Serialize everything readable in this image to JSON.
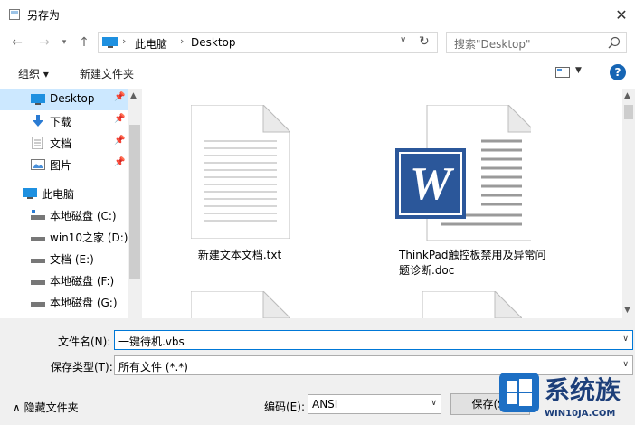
{
  "window": {
    "title": "另存为"
  },
  "address": {
    "segments": [
      "此电脑",
      "Desktop"
    ]
  },
  "search": {
    "placeholder": "搜索\"Desktop\""
  },
  "toolbar": {
    "organize": "组织 ▾",
    "new_folder": "新建文件夹",
    "help": "?"
  },
  "nav": {
    "items": [
      {
        "label": "Desktop",
        "icon": "desktop-icon",
        "pinned": true
      },
      {
        "label": "下载",
        "icon": "download-icon",
        "pinned": true
      },
      {
        "label": "文档",
        "icon": "documents-icon",
        "pinned": true
      },
      {
        "label": "图片",
        "icon": "pictures-icon",
        "pinned": true
      },
      {
        "label": "此电脑",
        "icon": "computer-icon",
        "pinned": false
      },
      {
        "label": "本地磁盘 (C:)",
        "icon": "drive-icon",
        "pinned": false
      },
      {
        "label": "win10之家 (D:)",
        "icon": "drive-icon",
        "pinned": false
      },
      {
        "label": "文档 (E:)",
        "icon": "drive-icon",
        "pinned": false
      },
      {
        "label": "本地磁盘 (F:)",
        "icon": "drive-icon",
        "pinned": false
      },
      {
        "label": "本地磁盘 (G:)",
        "icon": "drive-icon",
        "pinned": false
      }
    ]
  },
  "files": [
    {
      "name": "新建文本文档.txt",
      "type": "text-document-icon"
    },
    {
      "name": "ThinkPad触控板禁用及异常问题诊断.doc",
      "name_line1": "ThinkPad触控板禁用及异常问",
      "name_line2": "题诊断.doc",
      "type": "word-document-icon"
    }
  ],
  "form": {
    "filename_label": "文件名(N):",
    "filename_value": "一键待机.vbs",
    "filetype_label": "保存类型(T):",
    "filetype_value": "所有文件 (*.*)",
    "hide_folders": "隐藏文件夹",
    "encoding_label": "编码(E):",
    "encoding_value": "ANSI",
    "save_button": "保存(S)"
  },
  "watermark": {
    "text": "系统族",
    "url": "WIN10JA.COM"
  },
  "colors": {
    "selection": "#cce8ff",
    "word_blue": "#2b579a",
    "help_blue": "#1665b4"
  }
}
